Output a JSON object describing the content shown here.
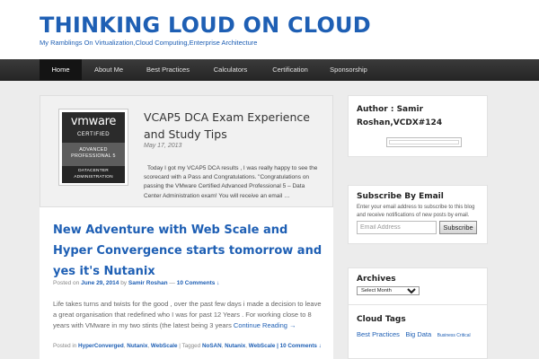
{
  "site": {
    "title": "THINKING LOUD ON CLOUD",
    "tagline": "My Ramblings On Virtualization,Cloud Computing,Enterprise Architecture"
  },
  "nav": {
    "items": [
      {
        "label": "Home",
        "active": true
      },
      {
        "label": "About Me",
        "active": false
      },
      {
        "label": "Best Practices",
        "active": false
      },
      {
        "label": "Calculators",
        "active": false
      },
      {
        "label": "Certification",
        "active": false
      },
      {
        "label": "Sponsorship",
        "active": false
      }
    ]
  },
  "featured": {
    "badge": {
      "logo": "vmware",
      "certified": "CERTIFIED",
      "level_line1": "ADVANCED",
      "level_line2": "PROFESSIONAL 5",
      "track_line1": "DATACENTER",
      "track_line2": "ADMINISTRATION"
    },
    "title": "VCAP5 DCA Exam Experience and Study Tips",
    "date": "May 17, 2013",
    "excerpt": "Today I got my VCAP5 DCA results , I was really happy to see the scorecard with a Pass and Congratulations. \"Congratulations on passing the VMware Certified Advanced Professional 5 – Data Center Administration exam! You will receive an email …"
  },
  "post": {
    "title": "New Adventure with Web Scale and Hyper Convergence starts tomorrow and yes it's Nutanix",
    "meta": {
      "posted_on": "Posted on",
      "date": "June 29, 2014",
      "by": "by",
      "author": "Samir Roshan",
      "sep": "—",
      "comments": "10 Comments ↓"
    },
    "excerpt": "Life takes turns and twists for the good , over the past few days i made a decision to leave a great organisation that redefined who I was for past 12 Years . For working close to 8 years with VMware in my two stints (the latest being 3 years",
    "continue": "Continue Reading →",
    "cats": {
      "posted_in": "Posted in",
      "categories": [
        "HyperConverged",
        "Nutanix",
        "WebScale"
      ],
      "tagged": "| Tagged",
      "tags": [
        "NoSAN",
        "Nutanix",
        "WebScale"
      ],
      "comments": "| 10 Comments ↓"
    }
  },
  "sidebar": {
    "author": {
      "title": "Author : Samir Roshan,VCDX#124"
    },
    "subscribe": {
      "title": "Subscribe By Email",
      "desc": "Enter your email address to subscribe to this blog and receive notifications of new posts by email.",
      "placeholder": "Email Address",
      "button": "Subscribe"
    },
    "archives": {
      "title": "Archives",
      "selected": "Select Month"
    },
    "tags": {
      "title": "Cloud Tags",
      "items": [
        {
          "label": "Best Practices",
          "size": "large"
        },
        {
          "label": "Big Data",
          "size": "large"
        },
        {
          "label": "Business Critical",
          "size": "small"
        }
      ]
    }
  },
  "colors": {
    "link": "#1e5fb4",
    "nav_bg": "#2f2f2f",
    "page_bg": "#ececec"
  }
}
